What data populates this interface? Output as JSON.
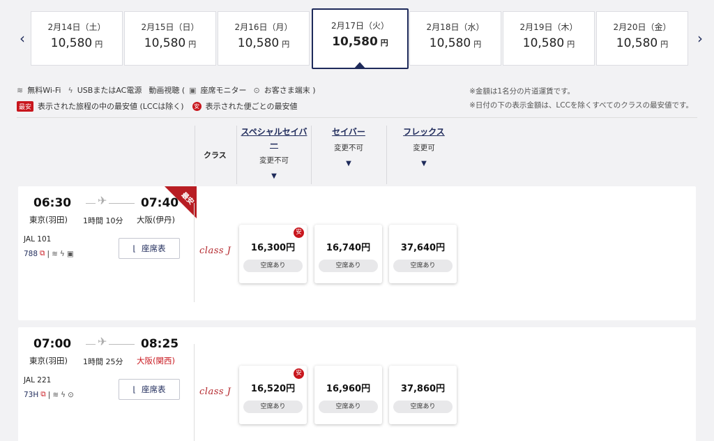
{
  "dates": [
    {
      "date": "2月14日（土）",
      "price": "10,580",
      "unit": "円"
    },
    {
      "date": "2月15日（日）",
      "price": "10,580",
      "unit": "円"
    },
    {
      "date": "2月16日（月）",
      "price": "10,580",
      "unit": "円"
    },
    {
      "date": "2月17日（火）",
      "price": "10,580",
      "unit": "円"
    },
    {
      "date": "2月18日（水）",
      "price": "10,580",
      "unit": "円"
    },
    {
      "date": "2月19日（木）",
      "price": "10,580",
      "unit": "円"
    },
    {
      "date": "2月20日（金）",
      "price": "10,580",
      "unit": "円"
    }
  ],
  "legend": {
    "wifi": "無料Wi-Fi",
    "power": "USBまたはAC電源",
    "video": "動画視聴 (",
    "seat_monitor": "座席モニター",
    "own_device": "お客さま端末 )",
    "lowest_badge": "最安",
    "lowest_text": "表示された旅程の中の最安値 (LCCは除く)",
    "an_badge": "安",
    "an_text": "表示された便ごとの最安値"
  },
  "notes": [
    "※金額は1名分の片道運賃です。",
    "※日付の下の表示金額は、LCCを除くすべてのクラスの最安値です。"
  ],
  "class_header": {
    "label": "クラス",
    "fares": [
      {
        "name": "スペシャルセイバー",
        "change": "変更不可"
      },
      {
        "name": "セイバー",
        "change": "変更不可"
      },
      {
        "name": "フレックス",
        "change": "変更可"
      }
    ]
  },
  "flights": [
    {
      "dep_time": "06:30",
      "arr_time": "07:40",
      "dep_airport": "東京(羽田)",
      "arr_airport": "大阪(伊丹)",
      "duration": "1時間 10分",
      "flight_no": "JAL  101",
      "aircraft": "788",
      "seat_button": "座席表",
      "ribbon": "最安",
      "class_logo": "class J",
      "fares": [
        {
          "price": "16,300円",
          "avail": "空席あり",
          "badge": "安"
        },
        {
          "price": "16,740円",
          "avail": "空席あり"
        },
        {
          "price": "37,640円",
          "avail": "空席あり"
        }
      ]
    },
    {
      "dep_time": "07:00",
      "arr_time": "08:25",
      "dep_airport": "東京(羽田)",
      "arr_airport": "大阪(関西)",
      "duration": "1時間 25分",
      "flight_no": "JAL  221",
      "aircraft": "73H",
      "seat_button": "座席表",
      "class_logo": "class J",
      "fares": [
        {
          "price": "16,520円",
          "avail": "空席あり",
          "badge": "安"
        },
        {
          "price": "16,960円",
          "avail": "空席あり"
        },
        {
          "price": "37,860円",
          "avail": "空席あり"
        }
      ]
    }
  ],
  "colors": {
    "navy": "#1e2a5a",
    "red": "#c8161d"
  }
}
